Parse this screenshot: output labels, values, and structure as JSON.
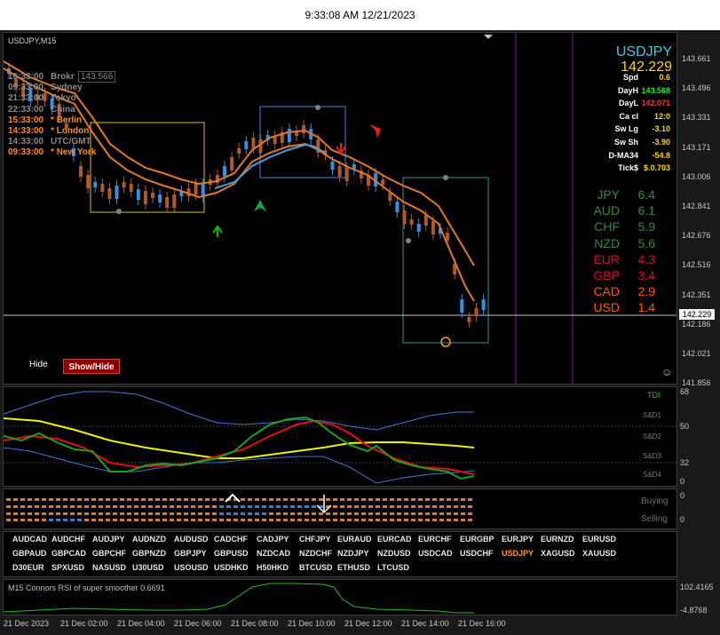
{
  "clock": "9:33:08 AM 12/21/2023",
  "chart_title": "USDJPY,M15",
  "hide_label": "Hide",
  "showhide_label": "Show/Hide",
  "sessions": [
    {
      "time": "16:33:00",
      "name": "Brokr",
      "color": "#8a8a8a"
    },
    {
      "time": "09:33:00",
      "name": "Sydney",
      "color": "#8a8a8a"
    },
    {
      "time": "21:33:00",
      "name": "Tokyo",
      "color": "#8a8a8a"
    },
    {
      "time": "22:33:00",
      "name": "China",
      "color": "#8a8a8a"
    },
    {
      "time": "15:33:00",
      "name": "* Berlin",
      "color": "#ff8c1a"
    },
    {
      "time": "14:33:00",
      "name": "* London",
      "color": "#ff8c1a"
    },
    {
      "time": "14:33:00",
      "name": "UTC/GMT",
      "color": "#8a8a8a"
    },
    {
      "time": "09:33:00",
      "name": "* New York",
      "color": "#ff8c1a"
    }
  ],
  "broker_price": "143.566",
  "info": {
    "symbol": "USDJPY",
    "price": "142.229",
    "rows": [
      {
        "k": "Spd",
        "v": "0.6",
        "c": "#ffd700"
      },
      {
        "k": "DayH",
        "v": "143.568",
        "c": "#00ff00"
      },
      {
        "k": "DayL",
        "v": "142.071",
        "c": "#ff3030"
      },
      {
        "k": "Ca cl",
        "v": "12:0",
        "c": "#ffd700"
      },
      {
        "k": "Sw Lg",
        "v": "-3.10",
        "c": "#ffd700"
      },
      {
        "k": "Sw Sh",
        "v": "-3.90",
        "c": "#ffd700"
      },
      {
        "k": "D-MA34",
        "v": "-54.8",
        "c": "#ffd700"
      },
      {
        "k": "Tick$",
        "v": "$.0.703",
        "c": "#ffd700"
      }
    ]
  },
  "strength": [
    {
      "cur": "JPY",
      "val": "6.4",
      "c": "#2e8b3a"
    },
    {
      "cur": "AUD",
      "val": "6.1",
      "c": "#2e8b3a"
    },
    {
      "cur": "CHF",
      "val": "5.9",
      "c": "#2e8b3a"
    },
    {
      "cur": "NZD",
      "val": "5.6",
      "c": "#2e8b3a"
    },
    {
      "cur": "EUR",
      "val": "4.3",
      "c": "#cc1030"
    },
    {
      "cur": "GBP",
      "val": "3.4",
      "c": "#cc1030"
    },
    {
      "cur": "CAD",
      "val": "2.9",
      "c": "#ff5a00"
    },
    {
      "cur": "USD",
      "val": "1.4",
      "c": "#ff5a00"
    }
  ],
  "price_axis": [
    "143.661",
    "143.496",
    "143.331",
    "143.171",
    "143.006",
    "142.841",
    "142.676",
    "142.516",
    "142.351",
    "142.186",
    "142.021",
    "141.856"
  ],
  "current_price_tag": "142.229",
  "tdi": {
    "label": "TDI",
    "axis": [
      "68",
      "50",
      "32",
      "0"
    ],
    "zones": [
      "S&D1",
      "S&D2",
      "S&D3",
      "S&D4"
    ]
  },
  "signals": {
    "buying": "Buying",
    "selling": "Selling",
    "axis": [
      "0",
      "0"
    ]
  },
  "pairs": [
    [
      "AUDCAD",
      "AUDCHF",
      "AUDJPY",
      "AUDNZD",
      "AUDUSD",
      "CADCHF",
      "CADJPY",
      "CHFJPY",
      "EURAUD",
      "EURCAD",
      "EURCHF",
      "EURGBP",
      "EURJPY",
      "EURNZD",
      "EURUSD"
    ],
    [
      "GBPAUD",
      "GBPCAD",
      "GBPCHF",
      "GBPNZD",
      "GBPJPY",
      "GBPUSD",
      "NZDCAD",
      "NZDCHF",
      "NZDJPY",
      "NZDUSD",
      "USDCAD",
      "USDCHF",
      "USDJPY",
      "XAGUSD",
      "XAUUSD"
    ],
    [
      "D30EUR",
      "SPXUSD",
      "NASUSD",
      "U30USD",
      "USOUSD",
      "USDHKD",
      "H50HKD",
      "BTCUSD",
      "ETHUSD",
      "LTCUSD"
    ]
  ],
  "active_pair": "USDJPY",
  "rsi": {
    "label": "M15 Connors RSI of super smoother 0.6691",
    "axis_top": "102.4165",
    "axis_bottom": "-4.8768"
  },
  "time_axis": [
    "21 Dec 2023",
    "21 Dec 02:00",
    "21 Dec 04:00",
    "21 Dec 06:00",
    "21 Dec 08:00",
    "21 Dec 10:00",
    "21 Dec 12:00",
    "21 Dec 14:00",
    "21 Dec 16:00"
  ]
}
